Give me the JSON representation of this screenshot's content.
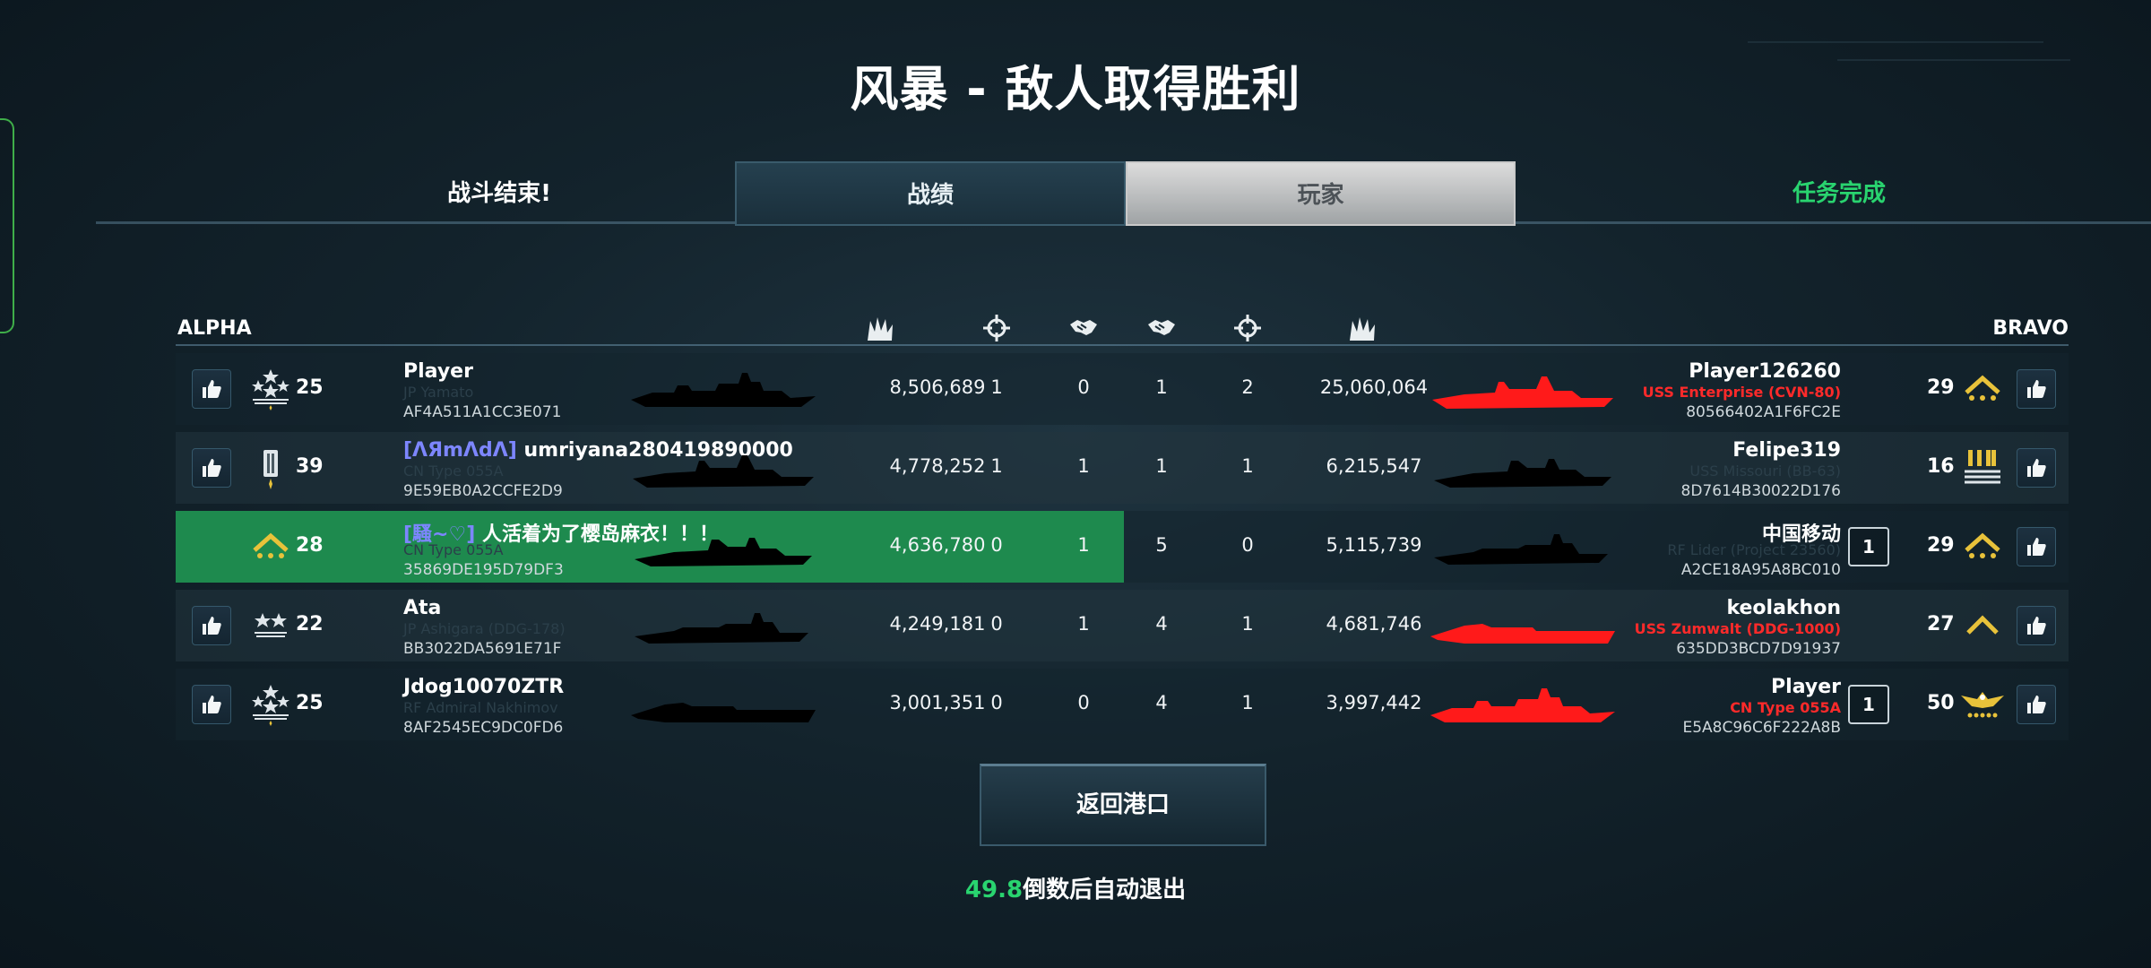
{
  "title": "风暴 - 敌人取得胜利",
  "tabs": {
    "battle_end": "战斗结束!",
    "stats": "战绩",
    "players": "玩家",
    "mission": "任务完成"
  },
  "teams": {
    "left": "ALPHA",
    "right": "BRAVO"
  },
  "header_icons": [
    "damage-icon",
    "kills-icon",
    "assists-icon",
    "assists-icon",
    "kills-icon",
    "damage-icon"
  ],
  "alpha": [
    {
      "name": "Player",
      "clan": "",
      "ship": "JP Yamato",
      "id": "AF4A511A1CC3E071",
      "level": "25",
      "rank_icon": "stars-3-icon",
      "damage": "8,506,689",
      "kills": "1",
      "assists": "0",
      "highlight": false,
      "liked": true
    },
    {
      "name": "umriyana280419890000",
      "clan": "[ɅЯmɅdɅ]",
      "ship": "CN Type 055A",
      "id": "9E59EB0A2CCFE2D9",
      "level": "39",
      "rank_icon": "bar-rank-icon",
      "damage": "4,778,252",
      "kills": "1",
      "assists": "1",
      "highlight": false,
      "liked": true
    },
    {
      "name": "人活着为了樱岛麻衣！！！",
      "clan": "[騷~♡]",
      "ship": "CN Type 055A",
      "id": "35869DE195D79DF3",
      "level": "28",
      "rank_icon": "chevron-rank-icon",
      "damage": "4,636,780",
      "kills": "0",
      "assists": "1",
      "highlight": true,
      "liked": false
    },
    {
      "name": "Ata",
      "clan": "",
      "ship": "JP Ashigara (DDG-178)",
      "id": "BB3022DA5691E71F",
      "level": "22",
      "rank_icon": "stars-2-icon",
      "damage": "4,249,181",
      "kills": "0",
      "assists": "1",
      "highlight": false,
      "liked": true
    },
    {
      "name": "Jdog10070ZTR",
      "clan": "",
      "ship": "RF Admiral Nakhimov",
      "id": "8AF2545EC9DC0FD6",
      "level": "25",
      "rank_icon": "stars-3-icon",
      "damage": "3,001,351",
      "kills": "0",
      "assists": "0",
      "highlight": false,
      "liked": true
    }
  ],
  "bravo": [
    {
      "name": "Player126260",
      "ship": "USS Enterprise (CVN-80)",
      "ship_red": true,
      "id": "80566402A1F6FC2E",
      "level": "29",
      "rank_icon": "chevron-rank-icon",
      "damage": "25,060,064",
      "kills": "2",
      "assists": "1",
      "badge": "",
      "ship_color": "red"
    },
    {
      "name": "Felipe319",
      "ship": "USS Missouri (BB-63)",
      "ship_red": false,
      "id": "8D7614B30022D176",
      "level": "16",
      "rank_icon": "bars-rank-icon",
      "damage": "6,215,547",
      "kills": "1",
      "assists": "1",
      "badge": "",
      "ship_color": "black"
    },
    {
      "name": "中国移动",
      "ship": "RF Lider (Project 23560)",
      "ship_red": false,
      "id": "A2CE18A95A8BC010",
      "level": "29",
      "rank_icon": "chevron-rank-icon",
      "damage": "5,115,739",
      "kills": "0",
      "assists": "5",
      "badge": "1",
      "ship_color": "black"
    },
    {
      "name": "keolakhon",
      "ship": "USS Zumwalt (DDG-1000)",
      "ship_red": true,
      "id": "635DD3BCD7D91937",
      "level": "27",
      "rank_icon": "chevron-single-icon",
      "damage": "4,681,746",
      "kills": "1",
      "assists": "4",
      "badge": "",
      "ship_color": "red"
    },
    {
      "name": "Player",
      "ship": "CN Type 055A",
      "ship_red": true,
      "id": "E5A8C96C6F222A8B",
      "level": "50",
      "rank_icon": "eagle-rank-icon",
      "damage": "3,997,442",
      "kills": "1",
      "assists": "4",
      "badge": "1",
      "ship_color": "red"
    }
  ],
  "return_button": "返回港口",
  "countdown": {
    "seconds": "49.8",
    "text": "倒数后自动退出"
  },
  "colors": {
    "accent_green": "#29d46f",
    "highlight_row": "#1e8a4e",
    "enemy_red": "#ff2a2a"
  }
}
